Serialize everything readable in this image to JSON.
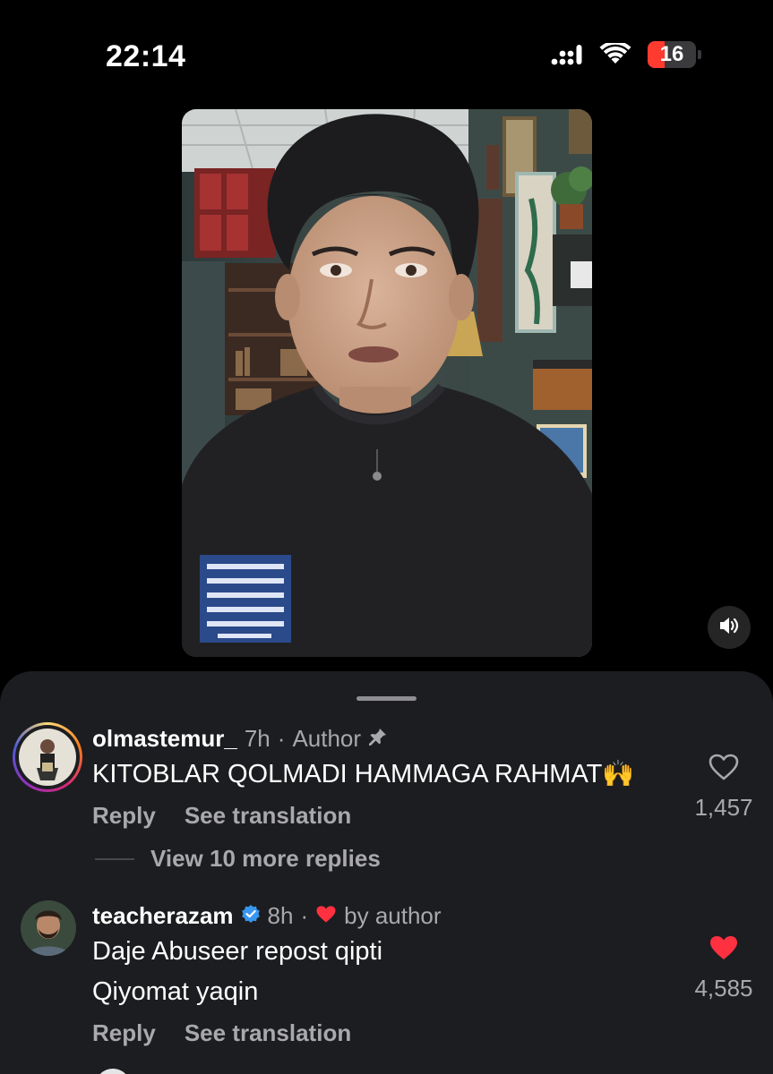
{
  "status_bar": {
    "time": "22:14",
    "battery_level": "16",
    "battery_fraction": 0.16,
    "icons": [
      "cellular-signal-icon",
      "wifi-icon",
      "battery-icon"
    ]
  },
  "video": {
    "shirt_patch_text": "But in the end one needs more courage to live than to kill himself",
    "sound_icon": "speaker-icon"
  },
  "comments": [
    {
      "username": "olmastemur_",
      "time": "7h",
      "badge": "Author",
      "pinned": true,
      "lines": [
        "KITOBLAR QOLMADI HAMMAGA RAHMAT🙌"
      ],
      "reply_label": "Reply",
      "translate_label": "See translation",
      "like_count": "1,457",
      "liked": false,
      "view_replies": "View 10 more replies"
    },
    {
      "username": "teacherazam",
      "verified": true,
      "time": "8h",
      "liked_by": "by author",
      "lines": [
        "Daje Abuseer repost qipti",
        "Qiyomat yaqin"
      ],
      "reply_label": "Reply",
      "translate_label": "See translation",
      "like_count": "4,585",
      "liked": true
    }
  ],
  "colors": {
    "background": "#000000",
    "sheet": "#1c1d20",
    "secondary_text": "#a8a8ad",
    "heart_red": "#ff3040",
    "verified_blue": "#3897f0",
    "battery_red": "#ff3b30"
  }
}
